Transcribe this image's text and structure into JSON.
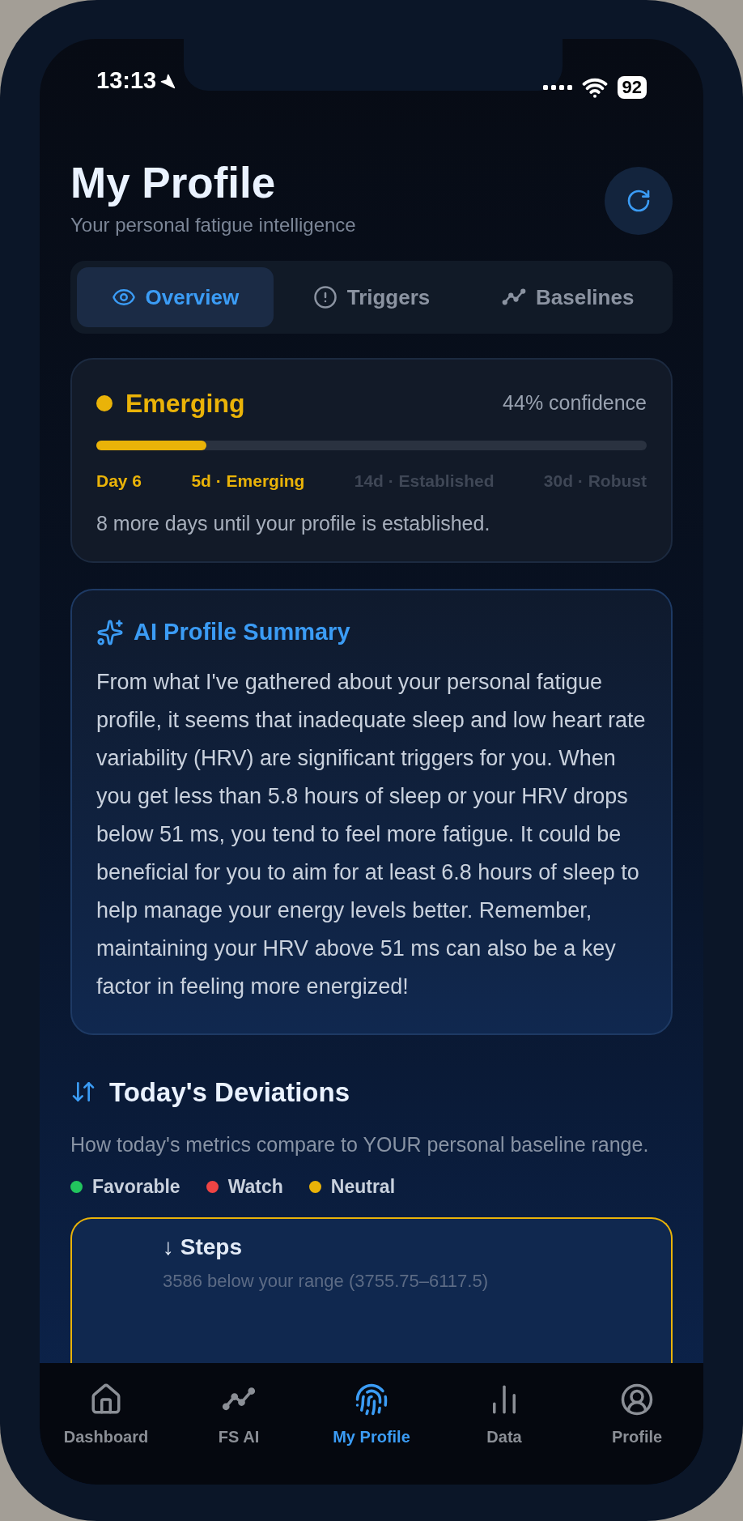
{
  "status_bar": {
    "time": "13:13",
    "battery": "92"
  },
  "header": {
    "title": "My Profile",
    "subtitle": "Your personal fatigue intelligence"
  },
  "tabs": [
    {
      "label": "Overview",
      "selected": true
    },
    {
      "label": "Triggers",
      "selected": false
    },
    {
      "label": "Baselines",
      "selected": false
    }
  ],
  "profile_status": {
    "label": "Emerging",
    "confidence": "44% confidence",
    "level": 0.2,
    "milestones": [
      {
        "label": "Day 6",
        "reached": true
      },
      {
        "label": "5d · Emerging",
        "reached": true
      },
      {
        "label": "14d · Established",
        "reached": false
      },
      {
        "label": "30d · Robust",
        "reached": false
      }
    ],
    "note": "8 more days until your profile is established."
  },
  "ai_summary": {
    "title": "AI Profile Summary",
    "text": "From what I've gathered about your personal fatigue profile, it seems that inadequate sleep and low heart rate variability (HRV) are significant triggers for you. When you get less than 5.8 hours of sleep or your HRV drops below 51 ms, you tend to feel more fatigue. It could be beneficial for you to aim for at least 6.8 hours of sleep to help manage your energy levels better. Remember, maintaining your HRV above 51 ms can also be a key factor in feeling more energized!"
  },
  "deviations": {
    "title": "Today's Deviations",
    "description": "How today's metrics compare to YOUR personal baseline range.",
    "legend": [
      {
        "label": "Favorable",
        "color": "#22c55e"
      },
      {
        "label": "Watch",
        "color": "#ef4444"
      },
      {
        "label": "Neutral",
        "color": "#eab308"
      }
    ],
    "items": [
      {
        "title": "↓ Steps",
        "detail": "3586 below your range (3755.75–6117.5)",
        "color": "#eab308"
      }
    ]
  },
  "nav": [
    {
      "label": "Dashboard",
      "selected": false
    },
    {
      "label": "FS AI",
      "selected": false
    },
    {
      "label": "My Profile",
      "selected": true
    },
    {
      "label": "Data",
      "selected": false
    },
    {
      "label": "Profile",
      "selected": false
    }
  ]
}
